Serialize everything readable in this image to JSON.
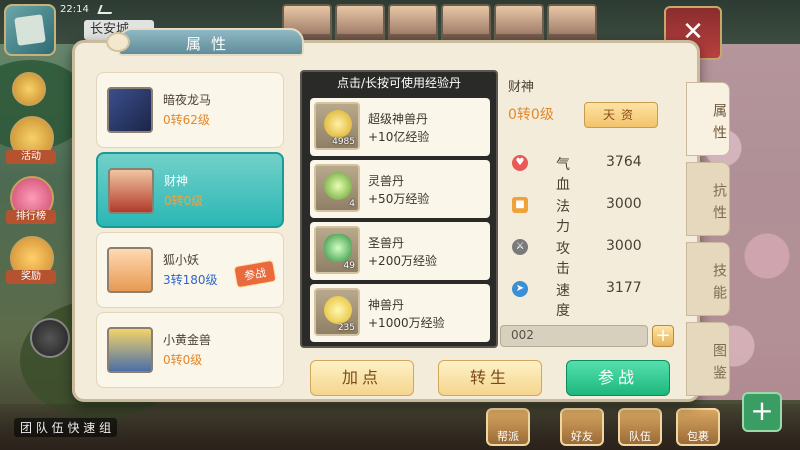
{
  "status": {
    "time": "22:14"
  },
  "location": "长安城",
  "panel_title": "属性",
  "pets": [
    {
      "name": "暗夜龙马",
      "level": "0转62级",
      "level_color": "orange",
      "selected": false,
      "battle": false
    },
    {
      "name": "财神",
      "level": "0转0级",
      "level_color": "orange",
      "selected": true,
      "battle": false
    },
    {
      "name": "狐小妖",
      "level": "3转180级",
      "level_color": "blue",
      "selected": false,
      "battle": true
    },
    {
      "name": "小黄金兽",
      "level": "0转0级",
      "level_color": "orange",
      "selected": false,
      "battle": false
    }
  ],
  "battle_badge": "参战",
  "exp_popup": {
    "title": "点击/长按可使用经验丹",
    "items": [
      {
        "name": "超级神兽丹",
        "desc": "+10亿经验",
        "count": "4985"
      },
      {
        "name": "灵兽丹",
        "desc": "+50万经验",
        "count": "4"
      },
      {
        "name": "圣兽丹",
        "desc": "+200万经验",
        "count": "49"
      },
      {
        "name": "神兽丹",
        "desc": "+1000万经验",
        "count": "235"
      }
    ]
  },
  "detail": {
    "name": "财神",
    "level": "0转0级",
    "talent_btn": "天资",
    "stats": [
      {
        "label": "气血",
        "value": "3764",
        "color": "#e85a55"
      },
      {
        "label": "法力",
        "value": "3000",
        "color": "#f0a23a"
      },
      {
        "label": "攻击",
        "value": "3000",
        "color": "#7a7a7a"
      },
      {
        "label": "速度",
        "value": "3177",
        "color": "#3b8fd4"
      }
    ],
    "exp_text": "002"
  },
  "actions": {
    "add_points": "加点",
    "rebirth": "转生",
    "battle": "参战"
  },
  "side_tabs": [
    "属性",
    "抗性",
    "技能",
    "图鉴"
  ],
  "left_icons": [
    "活动",
    "排行榜",
    "奖励"
  ],
  "bottom": {
    "text": "团 队 伍 快 速 组",
    "buttons": [
      "帮派",
      "好友",
      "队伍",
      "包裹",
      "更多"
    ]
  },
  "colors": {
    "accent_teal": "#2bb7b5",
    "accent_green": "#1db77d",
    "level_orange": "#e2882b",
    "level_blue": "#3066c9"
  }
}
